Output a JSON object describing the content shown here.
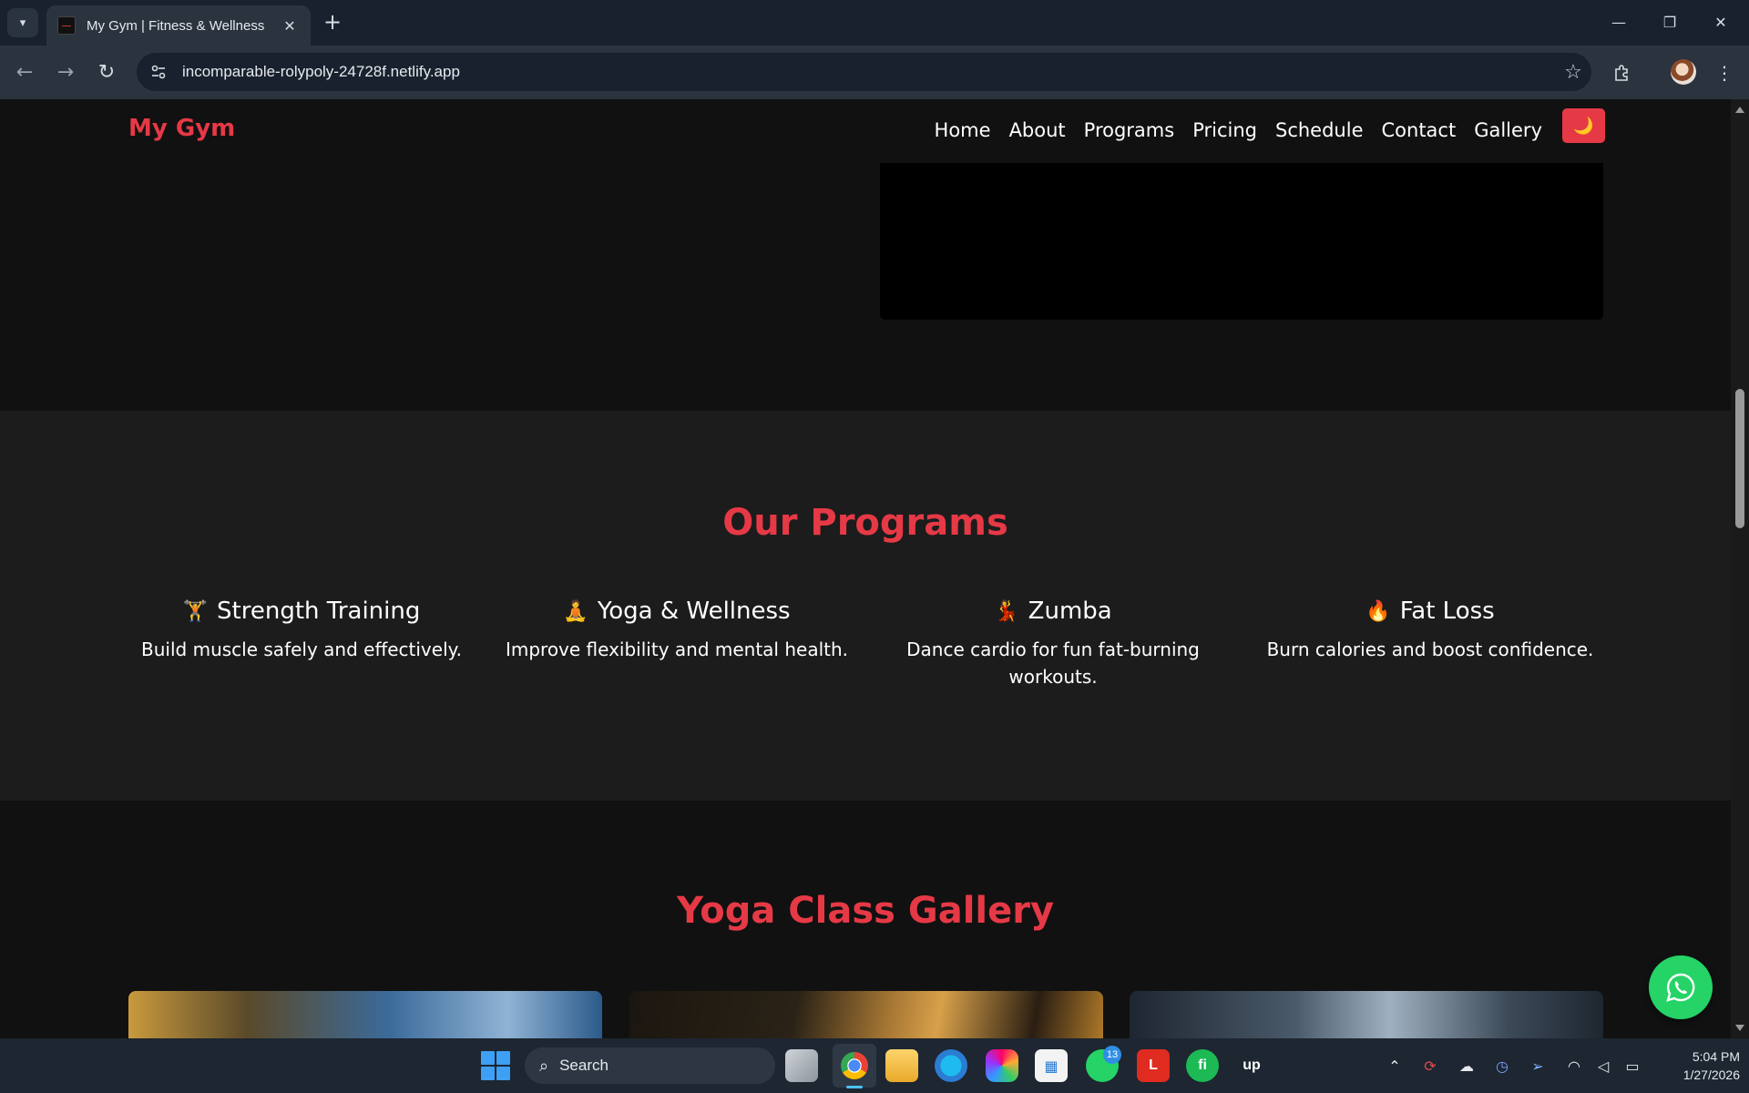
{
  "browser": {
    "tab_title": "My Gym | Fitness & Wellness",
    "url": "incomparable-rolypoly-24728f.netlify.app"
  },
  "site": {
    "logo": "My Gym",
    "nav": [
      "Home",
      "About",
      "Programs",
      "Pricing",
      "Schedule",
      "Contact",
      "Gallery"
    ],
    "theme_toggle_icon": "🌙"
  },
  "programs": {
    "title": "Our Programs",
    "items": [
      {
        "icon": "🏋️",
        "title": "Strength Training",
        "desc": "Build muscle safely and effectively."
      },
      {
        "icon": "🧘",
        "title": "Yoga & Wellness",
        "desc": "Improve flexibility and mental health."
      },
      {
        "icon": "💃",
        "title": "Zumba",
        "desc": "Dance cardio for fun fat-burning workouts."
      },
      {
        "icon": "🔥",
        "title": "Fat Loss",
        "desc": "Burn calories and boost confidence."
      }
    ]
  },
  "gallery": {
    "title": "Yoga Class Gallery"
  },
  "taskbar": {
    "search_placeholder": "Search",
    "whatsapp_badge": "13",
    "time": "5:04 PM",
    "date": "1/27/2026"
  },
  "colors": {
    "accent": "#e63946",
    "page_bg": "#111111",
    "section_bg": "#1c1c1c",
    "whatsapp": "#25d366"
  }
}
